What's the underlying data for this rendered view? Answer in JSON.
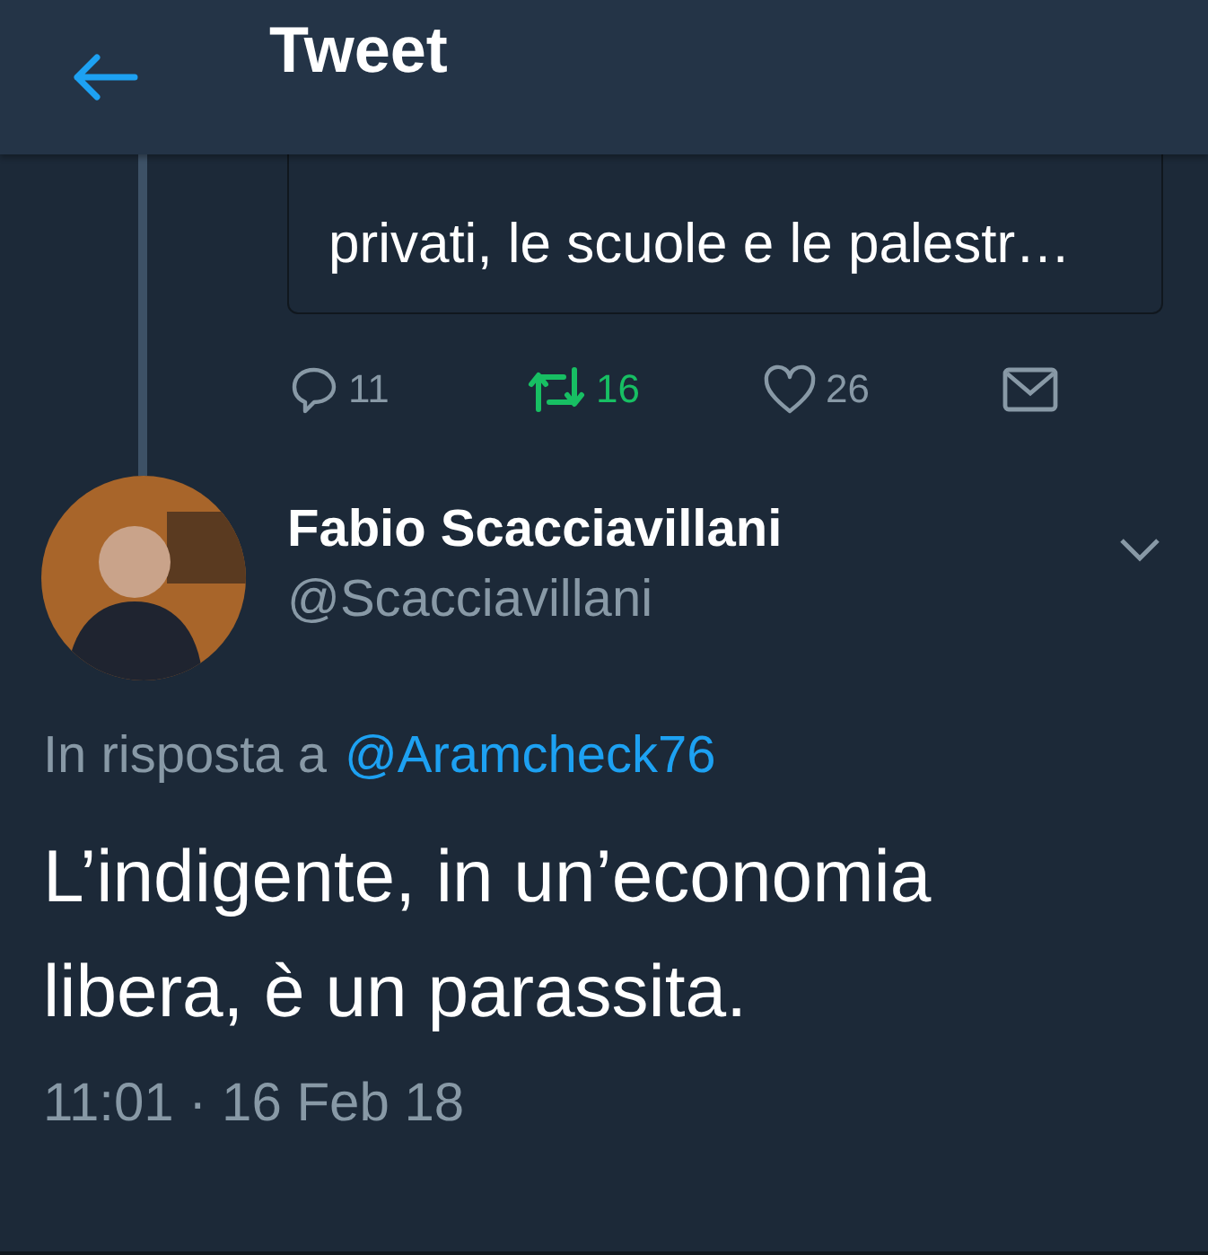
{
  "header": {
    "title": "Tweet"
  },
  "quoted_tweet": {
    "lines": [
      "privati, le scuole e le palestr…"
    ],
    "actions": [
      {
        "kind": "reply",
        "count": "11",
        "selected": false
      },
      {
        "kind": "retweet",
        "count": "16",
        "selected": true
      },
      {
        "kind": "like",
        "count": "26",
        "selected": false
      },
      {
        "kind": "message"
      }
    ]
  },
  "tweet": {
    "author": "Fabio Scacciavillani",
    "handle": "@Scacciavillani",
    "reply_prefix": "In risposta a",
    "reply_to": "@Aramcheck76",
    "text": "L’indigente, in un’economia libera, è un parassita.",
    "timestamp": "11:01 · 16 Feb 18"
  }
}
